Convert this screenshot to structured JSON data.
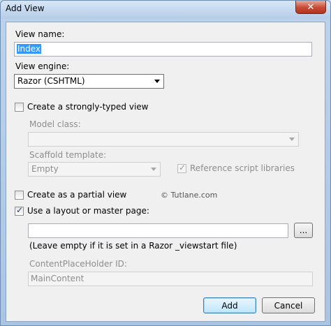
{
  "window": {
    "title": "Add View",
    "close_glyph": "✕"
  },
  "view_name": {
    "label": "View name:",
    "value": "Index"
  },
  "view_engine": {
    "label": "View engine:",
    "selected": "Razor (CSHTML)"
  },
  "strongly_typed": {
    "label": "Create a strongly-typed view",
    "checked": false
  },
  "model_class": {
    "label": "Model class:",
    "selected": ""
  },
  "scaffold": {
    "label": "Scaffold template:",
    "selected": "Empty"
  },
  "reference_scripts": {
    "label": "Reference script libraries",
    "checked": true
  },
  "partial_view": {
    "label": "Create as a partial view",
    "checked": false
  },
  "watermark": "© Tutlane.com",
  "layout": {
    "label": "Use a layout or master page:",
    "checked": true,
    "value": "",
    "browse_label": "...",
    "hint": "(Leave empty if it is set in a Razor _viewstart file)"
  },
  "content_placeholder": {
    "label": "ContentPlaceHolder ID:",
    "value": "MainContent"
  },
  "buttons": {
    "add": "Add",
    "cancel": "Cancel"
  },
  "icons": {
    "checkmark": "✓"
  }
}
